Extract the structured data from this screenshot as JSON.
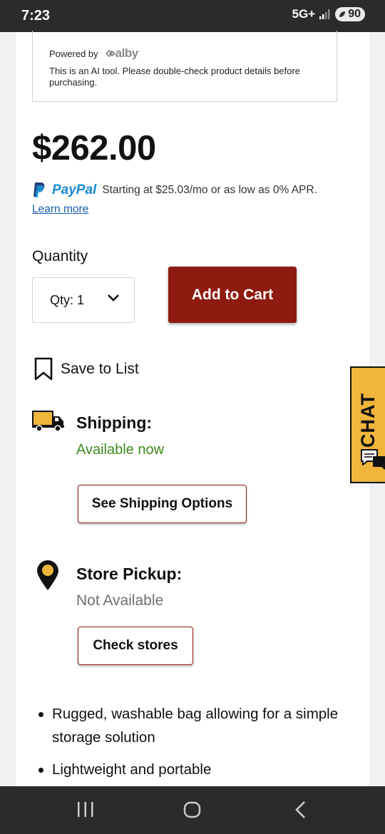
{
  "status_bar": {
    "time": "7:23",
    "network": "5G+",
    "battery": "90"
  },
  "alby": {
    "powered_by": "Powered by",
    "logo_text": "alby",
    "disclaimer": "This is an AI tool. Please double-check product details before purchasing."
  },
  "product": {
    "price": "$262.00"
  },
  "paypal": {
    "brand": "PayPal",
    "message": "Starting at $25.03/mo or as low as 0% APR.",
    "learn_more": "Learn more"
  },
  "quantity": {
    "label": "Quantity",
    "select_value": "Qty: 1"
  },
  "actions": {
    "add_to_cart": "Add to Cart",
    "save_to_list": "Save to List"
  },
  "shipping": {
    "title": "Shipping:",
    "status": "Available now",
    "status_color": "#3f8a1e",
    "button": "See Shipping Options"
  },
  "pickup": {
    "title": "Store Pickup:",
    "status": "Not Available",
    "button": "Check stores"
  },
  "features": [
    "Rugged, washable bag allowing for a simple storage solution",
    "Lightweight and portable"
  ],
  "chat": {
    "label": "CHAT",
    "color": "#f0b53b"
  },
  "colors": {
    "brand_red": "#8e1b10",
    "link_blue": "#1a5fb0"
  },
  "navigation": {
    "icons": [
      "recent-apps-icon",
      "home-icon",
      "back-icon"
    ]
  }
}
